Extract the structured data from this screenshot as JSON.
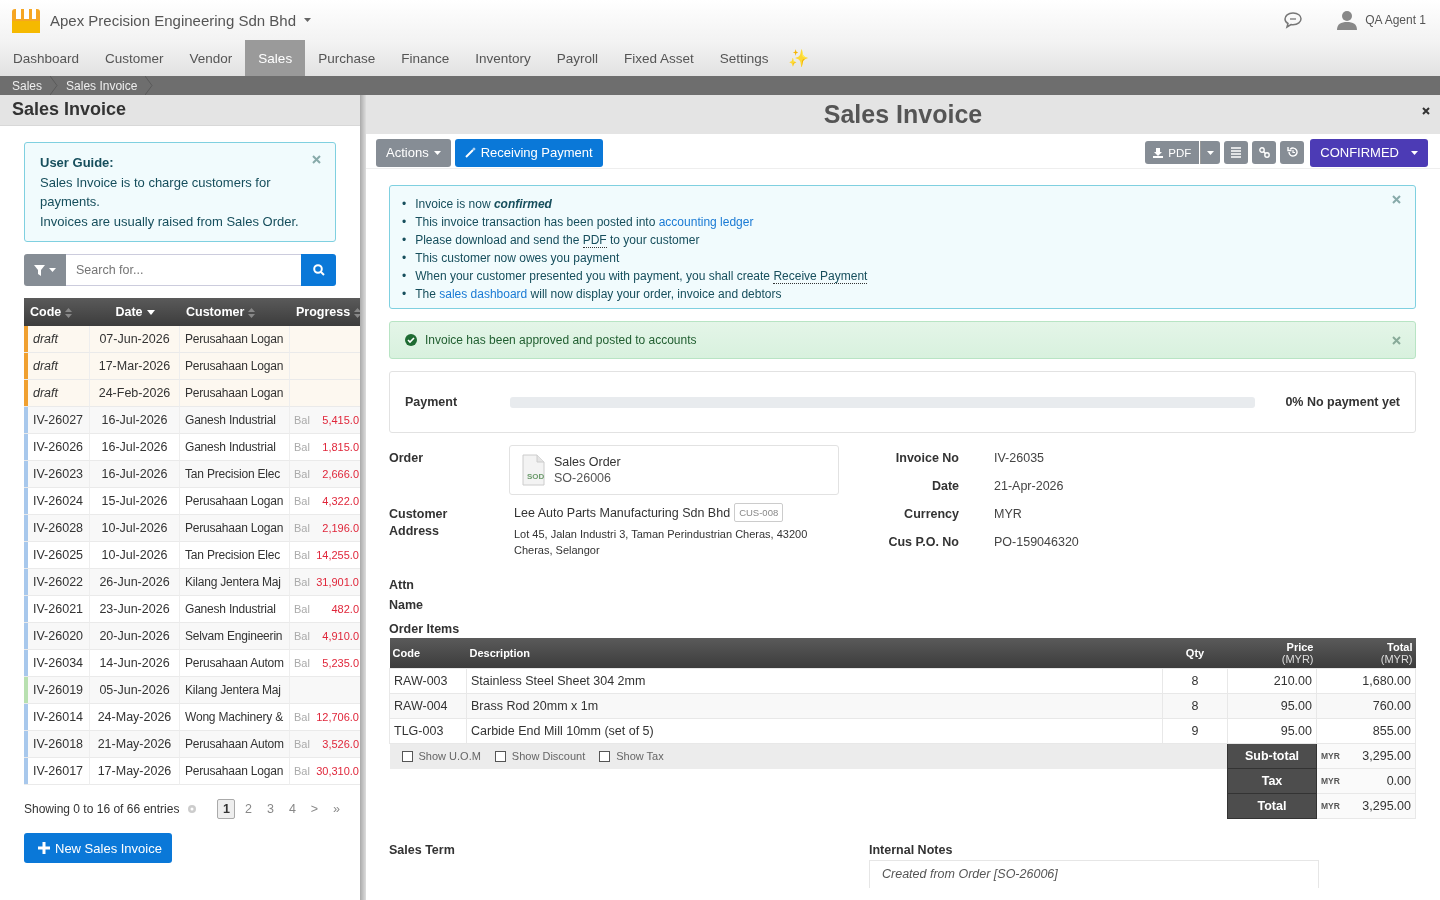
{
  "header": {
    "company": "Apex Precision Engineering Sdn Bhd",
    "user": "QA Agent 1"
  },
  "nav": [
    {
      "label": "Dashboard",
      "selected": false
    },
    {
      "label": "Customer",
      "selected": false
    },
    {
      "label": "Vendor",
      "selected": false
    },
    {
      "label": "Sales",
      "selected": true
    },
    {
      "label": "Purchase",
      "selected": false
    },
    {
      "label": "Finance",
      "selected": false
    },
    {
      "label": "Inventory",
      "selected": false
    },
    {
      "label": "Payroll",
      "selected": false
    },
    {
      "label": "Fixed Asset",
      "selected": false
    },
    {
      "label": "Settings",
      "selected": false
    }
  ],
  "nav_extra": "✨",
  "breadcrumb": [
    "Sales",
    "Sales Invoice"
  ],
  "list_panel": {
    "title": "Sales Invoice",
    "guide": {
      "title": "User Guide:",
      "lines": [
        "Sales Invoice is to charge customers for payments.",
        "Invoices are usually raised from Sales Order."
      ]
    },
    "search": {
      "placeholder": "Search for..."
    },
    "columns": [
      {
        "label": "Code",
        "sorted": false
      },
      {
        "label": "Date",
        "sorted": true
      },
      {
        "label": "Customer",
        "sorted": false
      },
      {
        "label": "Progress",
        "sorted": false
      }
    ],
    "rows": [
      {
        "code": "draft",
        "kind": "draft",
        "color": "#f0a030",
        "date": "07-Jun-2026",
        "customer": "Perusahaan Logan"
      },
      {
        "code": "draft",
        "kind": "draft",
        "color": "#f0a030",
        "date": "17-Mar-2026",
        "customer": "Perusahaan Logan"
      },
      {
        "code": "draft",
        "kind": "draft",
        "color": "#f0a030",
        "date": "24-Feb-2026",
        "customer": "Perusahaan Logan"
      },
      {
        "code": "IV-26027",
        "kind": "invoice",
        "color": "#a8c8ec",
        "date": "16-Jul-2026",
        "customer": "Ganesh Industrial",
        "bal_label": "Bal",
        "balance": "5,415.0"
      },
      {
        "code": "IV-26026",
        "kind": "invoice",
        "color": "#a8c8ec",
        "date": "16-Jul-2026",
        "customer": "Ganesh Industrial",
        "bal_label": "Bal",
        "balance": "1,815.0"
      },
      {
        "code": "IV-26023",
        "kind": "invoice",
        "color": "#a8c8ec",
        "date": "16-Jul-2026",
        "customer": "Tan Precision Elec",
        "bal_label": "Bal",
        "balance": "2,666.0"
      },
      {
        "code": "IV-26024",
        "kind": "invoice",
        "color": "#a8c8ec",
        "date": "15-Jul-2026",
        "customer": "Perusahaan Logan",
        "bal_label": "Bal",
        "balance": "4,322.0"
      },
      {
        "code": "IV-26028",
        "kind": "invoice",
        "color": "#a8c8ec",
        "date": "10-Jul-2026",
        "customer": "Perusahaan Logan",
        "bal_label": "Bal",
        "balance": "2,196.0"
      },
      {
        "code": "IV-26025",
        "kind": "invoice",
        "color": "#a8c8ec",
        "date": "10-Jul-2026",
        "customer": "Tan Precision Elec",
        "bal_label": "Bal",
        "balance": "14,255.0"
      },
      {
        "code": "IV-26022",
        "kind": "invoice",
        "color": "#a8c8ec",
        "date": "26-Jun-2026",
        "customer": "Kilang Jentera Maj",
        "bal_label": "Bal",
        "balance": "31,901.0"
      },
      {
        "code": "IV-26021",
        "kind": "invoice",
        "color": "#a8c8ec",
        "date": "23-Jun-2026",
        "customer": "Ganesh Industrial",
        "bal_label": "Bal",
        "balance": "482.0"
      },
      {
        "code": "IV-26020",
        "kind": "invoice",
        "color": "#a8c8ec",
        "date": "20-Jun-2026",
        "customer": "Selvam Engineerin",
        "bal_label": "Bal",
        "balance": "4,910.0"
      },
      {
        "code": "IV-26034",
        "kind": "invoice",
        "color": "#a8c8ec",
        "date": "14-Jun-2026",
        "customer": "Perusahaan Autom",
        "bal_label": "Bal",
        "balance": "5,235.0"
      },
      {
        "code": "IV-26019",
        "kind": "invoice",
        "color": "#b8e0b0",
        "date": "05-Jun-2026",
        "customer": "Kilang Jentera Maj"
      },
      {
        "code": "IV-26014",
        "kind": "invoice",
        "color": "#a8c8ec",
        "date": "24-May-2026",
        "customer": "Wong Machinery &",
        "bal_label": "Bal",
        "balance": "12,706.0"
      },
      {
        "code": "IV-26018",
        "kind": "invoice",
        "color": "#a8c8ec",
        "date": "21-May-2026",
        "customer": "Perusahaan Autom",
        "bal_label": "Bal",
        "balance": "3,526.0"
      },
      {
        "code": "IV-26017",
        "kind": "invoice",
        "color": "#a8c8ec",
        "date": "17-May-2026",
        "customer": "Perusahaan Logan",
        "bal_label": "Bal",
        "balance": "30,310.0"
      }
    ],
    "summary": "Showing 0 to 16 of 66 entries",
    "pages": [
      {
        "label": "1",
        "selected": true
      },
      {
        "label": "2",
        "selected": false
      },
      {
        "label": "3",
        "selected": false
      },
      {
        "label": "4",
        "selected": false
      },
      {
        "label": ">",
        "selected": false
      },
      {
        "label": "»",
        "selected": false
      }
    ],
    "new_button": "New Sales Invoice"
  },
  "detail": {
    "title": "Sales Invoice",
    "toolbar": {
      "actions": "Actions",
      "receive": "Receiving Payment",
      "pdf": "PDF",
      "status": "CONFIRMED"
    },
    "info": [
      {
        "bullet": "•",
        "parts": [
          {
            "kind": "text",
            "text": "Invoice is now "
          },
          {
            "kind": "emphasis",
            "text": "confirmed"
          }
        ]
      },
      {
        "bullet": "•",
        "parts": [
          {
            "kind": "text",
            "text": "This invoice transaction has been posted into "
          },
          {
            "kind": "link",
            "text": "accounting ledger"
          }
        ]
      },
      {
        "bullet": "•",
        "parts": [
          {
            "kind": "text",
            "text": "Please download and send the "
          },
          {
            "kind": "abbr",
            "text": "PDF"
          },
          {
            "kind": "text",
            "text": " to your customer"
          }
        ]
      },
      {
        "bullet": "•",
        "parts": [
          {
            "kind": "text",
            "text": "This customer now owes you payment"
          }
        ]
      },
      {
        "bullet": "•",
        "parts": [
          {
            "kind": "text",
            "text": "When your customer presented you with payment, you shall create "
          },
          {
            "kind": "abbr",
            "text": "Receive Payment"
          }
        ]
      },
      {
        "bullet": "•",
        "parts": [
          {
            "kind": "text",
            "text": "The "
          },
          {
            "kind": "link",
            "text": "sales dashboard"
          },
          {
            "kind": "text",
            "text": " will now display your order, invoice and debtors"
          }
        ]
      }
    ],
    "success": "Invoice has been approved and posted to accounts",
    "payment": {
      "label": "Payment",
      "level": 0,
      "status": "0% No payment yet"
    },
    "order": {
      "label": "Order",
      "doc_title": "Sales Order",
      "doc_no": "SO-26006",
      "icon_text": "SOD"
    },
    "customer": {
      "label": "Customer",
      "name": "Lee Auto Parts Manufacturing Sdn Bhd",
      "code": "CUS-008"
    },
    "address": {
      "label": "Address",
      "lines": [
        "Lot 45, Jalan Industri 3, Taman Perindustrian Cheras, 43200",
        "Cheras, Selangor"
      ]
    },
    "attn": [
      "Attn",
      "Name"
    ],
    "fields": [
      {
        "label": "Invoice No",
        "value": "IV-26035"
      },
      {
        "label": "Date",
        "value": "21-Apr-2026"
      },
      {
        "label": "Currency",
        "value": "MYR"
      },
      {
        "label": "Cus P.O. No",
        "value": "PO-159046320"
      }
    ],
    "items_title": "Order Items",
    "item_columns": [
      {
        "label": "Code"
      },
      {
        "label": "Description"
      },
      {
        "label": "Qty"
      },
      {
        "label": "Price",
        "sub": "(MYR)"
      },
      {
        "label": "Total",
        "sub": "(MYR)"
      }
    ],
    "items": [
      {
        "code": "RAW-003",
        "description": "Stainless Steel Sheet 304 2mm",
        "qty": "8",
        "price": "210.00",
        "total": "1,680.00"
      },
      {
        "code": "RAW-004",
        "description": "Brass Rod 20mm x 1m",
        "qty": "8",
        "price": "95.00",
        "total": "760.00"
      },
      {
        "code": "TLG-003",
        "description": "Carbide End Mill 10mm (set of 5)",
        "qty": "9",
        "price": "95.00",
        "total": "855.00"
      }
    ],
    "options": [
      {
        "label": "Show U.O.M",
        "checked": false
      },
      {
        "label": "Show Discount",
        "checked": false
      },
      {
        "label": "Show Tax",
        "checked": false
      }
    ],
    "totals": [
      {
        "label": "Sub-total",
        "currency": "MYR",
        "value": "3,295.00"
      },
      {
        "label": "Tax",
        "currency": "MYR",
        "value": "0.00"
      },
      {
        "label": "Total",
        "currency": "MYR",
        "value": "3,295.00"
      }
    ],
    "sales_term": "Sales Term",
    "notes": {
      "label": "Internal Notes",
      "value": "Created from Order [SO-26006]"
    }
  }
}
